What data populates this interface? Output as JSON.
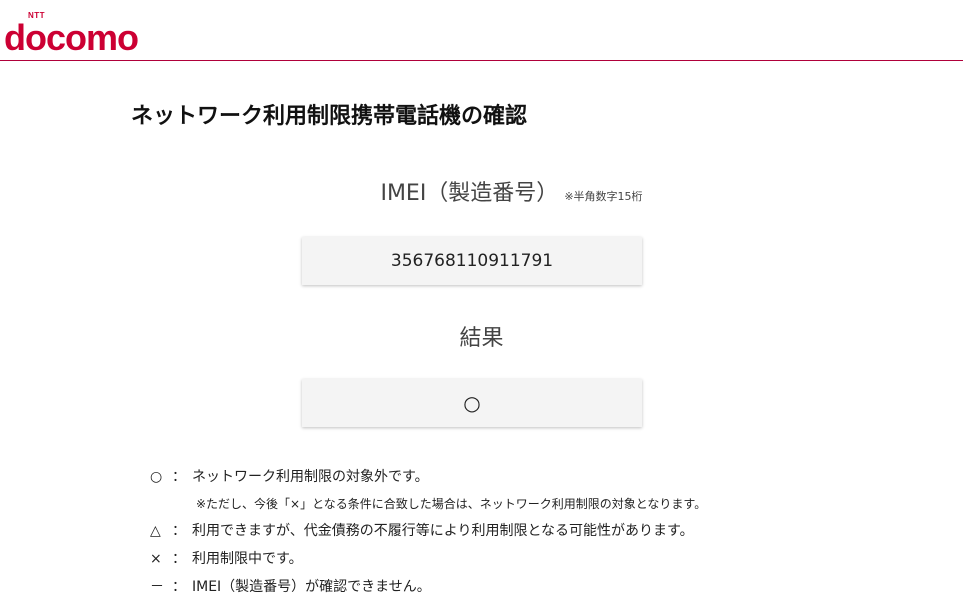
{
  "header": {
    "logo_ntt": "NTT",
    "logo_text": "docomo",
    "brand_color": "#cc0033"
  },
  "page_title": "ネットワーク利用制限携帯電話機の確認",
  "imei": {
    "label": "IMEI（製造番号）",
    "note": "※半角数字15桁",
    "value": "356768110911791"
  },
  "result": {
    "label": "結果",
    "value": "○"
  },
  "legend": [
    {
      "symbol": "○",
      "colon": "：",
      "text": "ネットワーク利用制限の対象外です。"
    },
    {
      "note": "※ただし、今後「×」となる条件に合致した場合は、ネットワーク利用制限の対象となります。"
    },
    {
      "symbol": "△",
      "colon": "：",
      "text": "利用できますが、代金債務の不履行等により利用制限となる可能性があります。"
    },
    {
      "symbol": "×",
      "colon": "：",
      "text": "利用制限中です。"
    },
    {
      "symbol": "－",
      "colon": "：",
      "text": "IMEI（製造番号）が確認できません。"
    }
  ]
}
